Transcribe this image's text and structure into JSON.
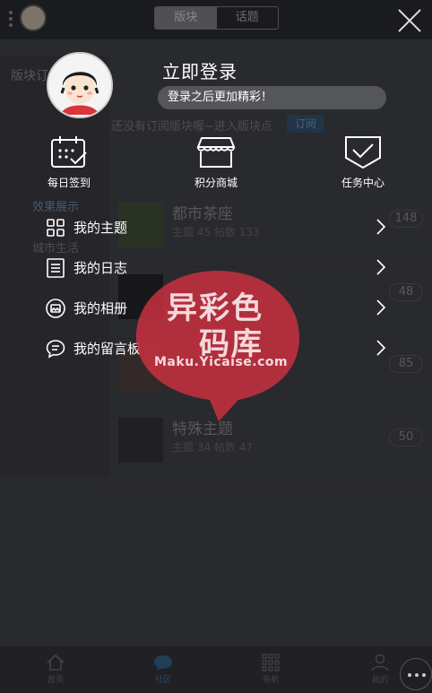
{
  "background": {
    "segments": [
      "版块",
      "话题"
    ],
    "header_label": "版块订",
    "notice": "还没有订阅版块喔~进入版块点",
    "subscribe_label": "订阅",
    "left_items": [
      "效果展示",
      "城市生活"
    ],
    "rows": [
      {
        "title": "都市茶座",
        "meta": "主题 45 帖数 133",
        "count": "148"
      },
      {
        "title": "",
        "meta": "",
        "count": "48"
      },
      {
        "title": "",
        "meta": "",
        "count": "85"
      },
      {
        "title": "特殊主题",
        "meta": "主题 34 帖数 47",
        "count": "50"
      }
    ],
    "tabs": [
      {
        "label": "首页",
        "icon": "home-icon"
      },
      {
        "label": "社区",
        "icon": "chat-bubble-icon"
      },
      {
        "label": "导航",
        "icon": "grid-icon"
      },
      {
        "label": "我的",
        "icon": "person-icon"
      }
    ]
  },
  "drawer": {
    "login_title": "立即登录",
    "login_subtitle": "登录之后更加精彩！",
    "quick_actions": [
      {
        "label": "每日签到",
        "icon": "calendar-check-icon"
      },
      {
        "label": "积分商城",
        "icon": "store-icon"
      },
      {
        "label": "任务中心",
        "icon": "task-check-icon"
      }
    ],
    "menu": [
      {
        "label": "我的主题",
        "icon": "grid-four-icon"
      },
      {
        "label": "我的日志",
        "icon": "document-lines-icon"
      },
      {
        "label": "我的相册",
        "icon": "photo-icon"
      },
      {
        "label": "我的留言板",
        "icon": "message-board-icon"
      }
    ]
  },
  "watermark": {
    "line1": "异彩色",
    "line2": "码库",
    "url": "Maku.Yicaise.com"
  },
  "colors": {
    "overlay": "#1a1a1e",
    "accent_blue": "#2d4d66",
    "watermark_red": "#c4303f"
  }
}
